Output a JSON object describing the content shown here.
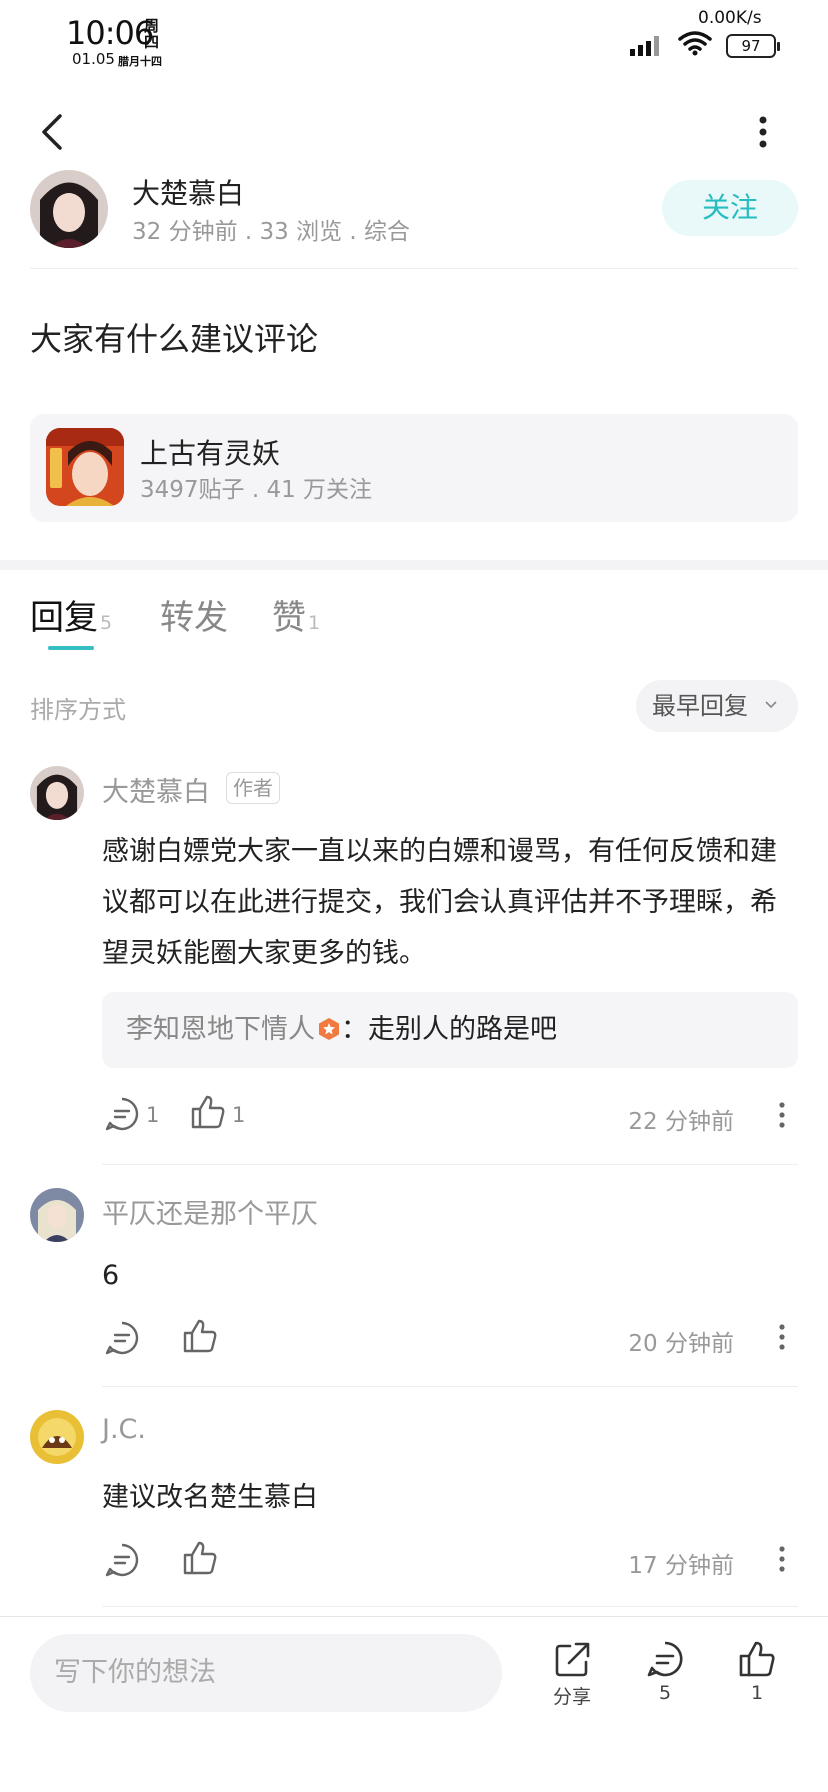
{
  "status": {
    "time": "10:06",
    "weekday": "周四",
    "date": "01.05",
    "lunar": "腊月十四",
    "net_speed": "0.00K/s",
    "battery": "97"
  },
  "author": {
    "name": "大楚慕白",
    "meta": "32 分钟前 . 33 浏览 . 综合",
    "follow_label": "关注"
  },
  "post": {
    "title": "大家有什么建议评论"
  },
  "forum": {
    "name": "上古有灵妖",
    "meta": "3497贴子 . 41 万关注"
  },
  "tabs": [
    {
      "label": "回复",
      "count": "5"
    },
    {
      "label": "转发",
      "count": ""
    },
    {
      "label": "赞",
      "count": "1"
    }
  ],
  "sort": {
    "label": "排序方式",
    "value": "最早回复"
  },
  "comments": [
    {
      "name": "大楚慕白",
      "tag": "作者",
      "text": "感谢白嫖党大家一直以来的白嫖和谩骂，有任何反馈和建议都可以在此进行提交，我们会认真评估并不予理睬，希望灵妖能圈大家更多的钱。",
      "reply": {
        "name": "李知恩地下情人",
        "sep": "：",
        "text": "走别人的路是吧"
      },
      "comment_count": "1",
      "like_count": "1",
      "time": "22 分钟前"
    },
    {
      "name": "平仄还是那个平仄",
      "text": "6",
      "comment_count": "",
      "like_count": "",
      "time": "20 分钟前"
    },
    {
      "name": "J.C.",
      "text": "建议改名楚生慕白",
      "comment_count": "",
      "like_count": "",
      "time": "17 分钟前"
    }
  ],
  "bottom": {
    "placeholder": "写下你的想法",
    "share_label": "分享",
    "comment_count": "5",
    "like_count": "1"
  },
  "colors": {
    "accent": "#35bfc2",
    "follow_bg": "#e9f8f8",
    "badge": "#f07a40"
  }
}
